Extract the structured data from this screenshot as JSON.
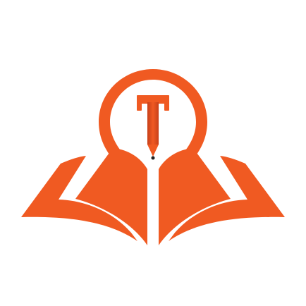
{
  "logo": {
    "name": "book-lightbulb-pen-logo",
    "letter": "T",
    "colors": {
      "primary": "#F05A22",
      "primary_dark": "#C8401A",
      "background": "#FFFFFF"
    }
  }
}
